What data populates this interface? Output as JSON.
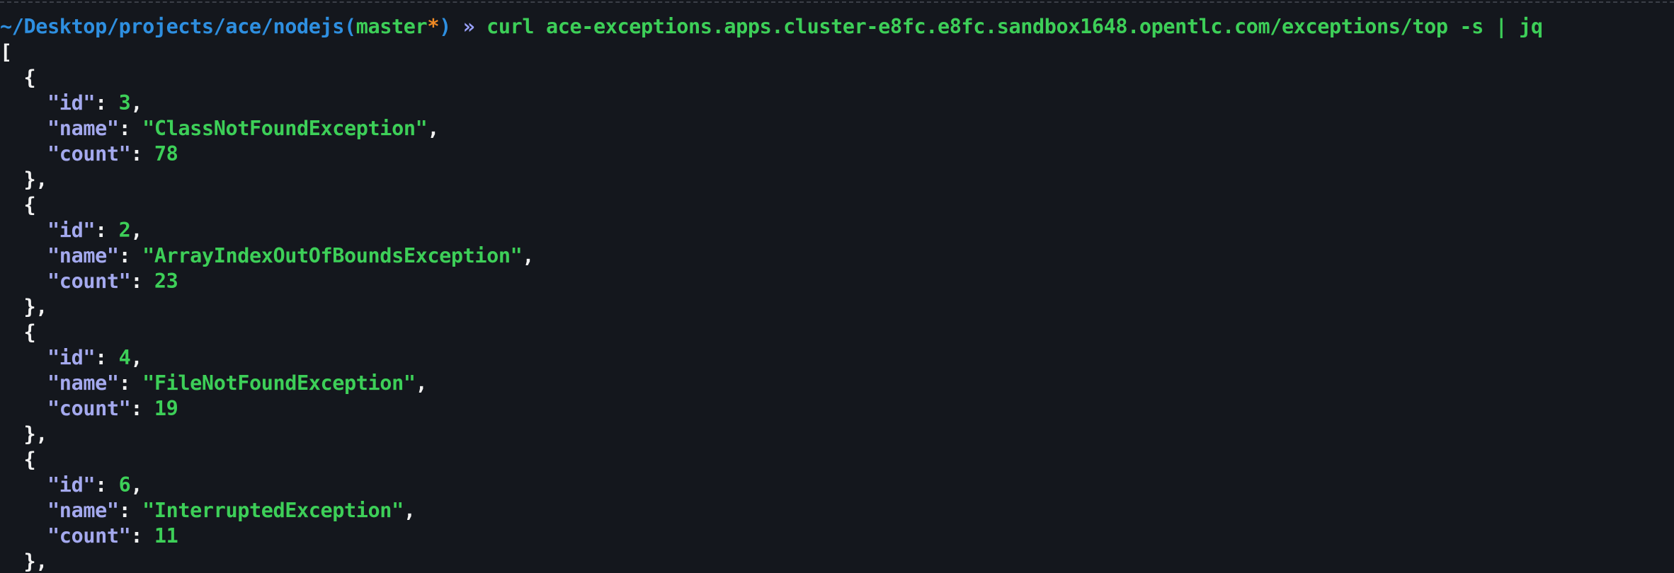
{
  "prompt": {
    "path": "~/Desktop/projects/ace/nodejs",
    "open_paren": "(",
    "branch": "master",
    "dirty_marker": "*",
    "close_paren": ")",
    "separator": "»",
    "command": "curl ace-exceptions.apps.cluster-e8fc.e8fc.sandbox1648.opentlc.com/exceptions/top -s | jq"
  },
  "output": {
    "open_bracket": "[",
    "records": [
      {
        "id": "3",
        "name": "\"ClassNotFoundException\"",
        "count": "78"
      },
      {
        "id": "2",
        "name": "\"ArrayIndexOutOfBoundsException\"",
        "count": "23"
      },
      {
        "id": "4",
        "name": "\"FileNotFoundException\"",
        "count": "19"
      },
      {
        "id": "6",
        "name": "\"InterruptedException\"",
        "count": "11"
      }
    ],
    "labels": {
      "id_key": "\"id\"",
      "name_key": "\"name\"",
      "count_key": "\"count\"",
      "open_brace": "{",
      "close_brace": "},",
      "colon": ": ",
      "comma": ","
    }
  },
  "colors": {
    "background": "#14171d",
    "path": "#2e8fe0",
    "green": "#3dcf58",
    "orange": "#f08a24",
    "key": "#a4a9ee",
    "white": "#f1f1f1"
  }
}
